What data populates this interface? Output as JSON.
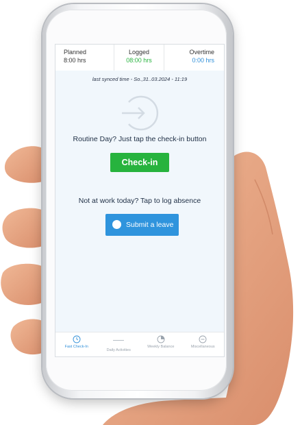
{
  "stats": {
    "planned": {
      "label": "Planned",
      "value": "8:00 hrs"
    },
    "logged": {
      "label": "Logged",
      "value": "08:00 hrs"
    },
    "overtime": {
      "label": "Overtime",
      "value": "0:00 hrs"
    }
  },
  "sync_text": "last synced time - So.,31..03.2024 - 11:19",
  "routine_text": "Routine Day? Just tap the check-in button",
  "checkin_label": "Check-in",
  "absence_text": "Not at work today? Tap to log absence",
  "leave_label": "Submit a leave",
  "nav": [
    {
      "label": "Fast Check-In",
      "icon": "clock-icon",
      "active": true
    },
    {
      "label": "Daily Activities",
      "icon": "line-icon",
      "active": false
    },
    {
      "label": "Weekly Balance",
      "icon": "pie-chart-icon",
      "active": false
    },
    {
      "label": "Miscellaneous",
      "icon": "more-icon",
      "active": false
    }
  ],
  "colors": {
    "logged": "#27b33e",
    "overtime": "#2f8fd8",
    "checkin_button": "#27b33e",
    "leave_button": "#2f94dd",
    "nav_active": "#2f8fd8"
  }
}
